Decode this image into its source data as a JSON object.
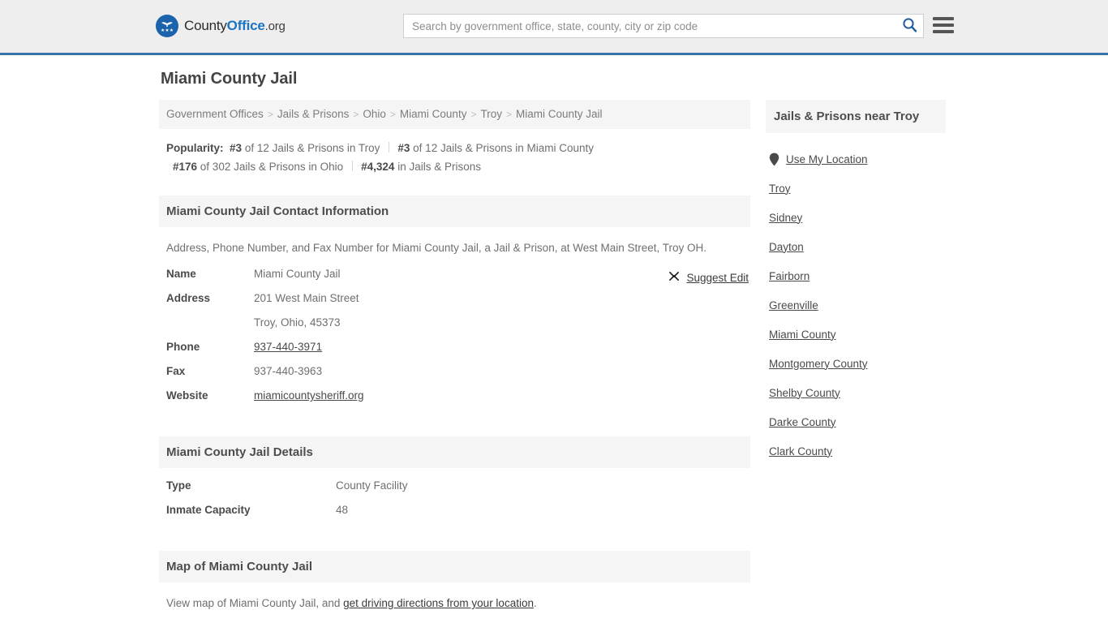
{
  "header": {
    "logo": {
      "part1": "County",
      "part2": "Office",
      "part3": ".org",
      "icon": "eagle-emblem-icon"
    },
    "search": {
      "placeholder": "Search by government office, state, county, city or zip code",
      "value": "",
      "icon": "search-icon"
    },
    "menu_icon": "hamburger-menu-icon",
    "accent_color": "#3a72a8"
  },
  "page": {
    "title": "Miami County Jail"
  },
  "breadcrumb": {
    "separator": ">",
    "items": [
      {
        "label": "Government Offices"
      },
      {
        "label": "Jails & Prisons"
      },
      {
        "label": "Ohio"
      },
      {
        "label": "Miami County"
      },
      {
        "label": "Troy"
      },
      {
        "label": "Miami County Jail"
      }
    ]
  },
  "popularity": {
    "label": "Popularity:",
    "rows": [
      [
        {
          "rank": "#3",
          "text": " of 12 Jails & Prisons in Troy"
        },
        {
          "rank": "#3",
          "text": " of 12 Jails & Prisons in Miami County"
        }
      ],
      [
        {
          "rank": "#176",
          "text": " of 302 Jails & Prisons in Ohio"
        },
        {
          "rank": "#4,324",
          "text": " in Jails & Prisons"
        }
      ]
    ]
  },
  "contact": {
    "heading": "Miami County Jail Contact Information",
    "intro": "Address, Phone Number, and Fax Number for Miami County Jail, a Jail & Prison, at West Main Street, Troy OH.",
    "suggest_edit": {
      "label": "Suggest Edit",
      "icon": "edit-pencil-icon"
    },
    "rows": [
      {
        "term": "Name",
        "value": "Miami County Jail",
        "link": false
      },
      {
        "term": "Address",
        "value": "201 West Main Street",
        "link": false
      },
      {
        "term": "",
        "value": "Troy, Ohio, 45373",
        "link": false
      },
      {
        "term": "Phone",
        "value": "937-440-3971",
        "link": true
      },
      {
        "term": "Fax",
        "value": "937-440-3963",
        "link": false
      },
      {
        "term": "Website",
        "value": "miamicountysheriff.org",
        "link": true
      }
    ]
  },
  "details": {
    "heading": "Miami County Jail Details",
    "rows": [
      {
        "term": "Type",
        "value": "County Facility"
      },
      {
        "term": "Inmate Capacity",
        "value": "48"
      }
    ]
  },
  "map": {
    "heading": "Map of Miami County Jail",
    "intro_prefix": "View map of Miami County Jail, and ",
    "link": "get driving directions from your location",
    "intro_suffix": "."
  },
  "sidebar": {
    "heading": "Jails & Prisons near Troy",
    "use_my_location": {
      "label": "Use My Location",
      "icon": "map-pin-icon"
    },
    "items": [
      {
        "label": "Troy"
      },
      {
        "label": "Sidney"
      },
      {
        "label": "Dayton"
      },
      {
        "label": "Fairborn"
      },
      {
        "label": "Greenville"
      },
      {
        "label": "Miami County"
      },
      {
        "label": "Montgomery County"
      },
      {
        "label": "Shelby County"
      },
      {
        "label": "Darke County"
      },
      {
        "label": "Clark County"
      }
    ]
  }
}
